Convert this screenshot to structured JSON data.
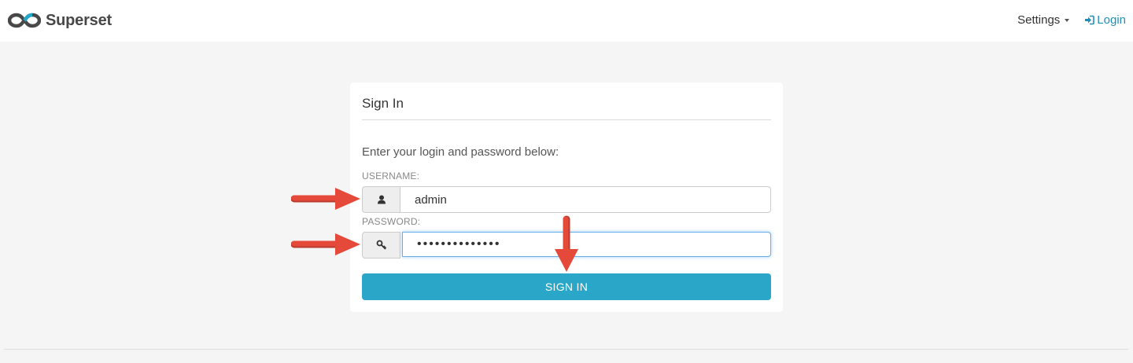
{
  "navbar": {
    "brand": "Superset",
    "settings_label": "Settings",
    "login_label": "Login"
  },
  "login_panel": {
    "title": "Sign In",
    "instructions": "Enter your login and password below:",
    "username_label": "USERNAME:",
    "username_value": "admin",
    "password_label": "PASSWORD:",
    "password_value": "••••••••••••••",
    "submit_label": "SIGN IN"
  },
  "icons": {
    "user": "user-icon",
    "password": "key-icon",
    "login": "sign-in-icon"
  },
  "colors": {
    "brand_text": "#484848",
    "link": "#1f8fb7",
    "button": "#2aa6c9",
    "annotation_arrow": "#e5493a"
  }
}
